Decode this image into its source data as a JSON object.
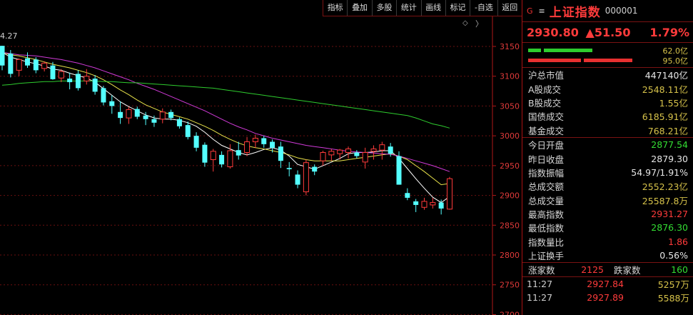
{
  "toolbar": {
    "buttons": [
      "指标",
      "叠加",
      "多股",
      "统计",
      "画线",
      "标记",
      "-自选",
      "返回"
    ]
  },
  "panel": {
    "g_icon": "G",
    "menu_icon": "≡",
    "index_name": "上证指数",
    "index_code": "000001",
    "last": "2930.80",
    "change": "▲51.50",
    "change_pct": "1.79%",
    "bar1_val": "62.0亿",
    "bar2_val": "95.0亿",
    "stats": [
      {
        "label": "沪总市值",
        "value": "447140亿",
        "color": "white"
      },
      {
        "label": "A股成交",
        "value": "2548.11亿",
        "color": "yellow"
      },
      {
        "label": "B股成交",
        "value": "1.55亿",
        "color": "yellow"
      },
      {
        "label": "国债成交",
        "value": "6185.91亿",
        "color": "yellow"
      },
      {
        "label": "基金成交",
        "value": "768.21亿",
        "color": "yellow"
      }
    ],
    "stats2": [
      {
        "label": "今日开盘",
        "value": "2877.54",
        "color": "green"
      },
      {
        "label": "昨日收盘",
        "value": "2879.30",
        "color": "white"
      },
      {
        "label": "指数振幅",
        "value": "54.97/1.91%",
        "color": "white"
      },
      {
        "label": "总成交额",
        "value": "2552.23亿",
        "color": "yellow"
      },
      {
        "label": "总成交量",
        "value": "25587.8万",
        "color": "yellow"
      },
      {
        "label": "最高指数",
        "value": "2931.27",
        "color": "red"
      },
      {
        "label": "最低指数",
        "value": "2876.30",
        "color": "green"
      },
      {
        "label": "指数量比",
        "value": "1.86",
        "color": "red"
      },
      {
        "label": "上证换手",
        "value": "0.56%",
        "color": "white"
      }
    ],
    "up_label": "涨家数",
    "up_count": "2125",
    "down_label": "跌家数",
    "down_count": "160",
    "ticks": [
      {
        "time": "11:27",
        "price": "2927.84",
        "vol": "5257万"
      },
      {
        "time": "11:27",
        "price": "2927.89",
        "vol": "5588万"
      }
    ]
  },
  "chart_data": {
    "type": "candlestick",
    "top_label": "4.27",
    "y_ticks": [
      "3150",
      "3100",
      "3050",
      "3000",
      "2950",
      "2900",
      "2850",
      "2800",
      "2750",
      "2700"
    ],
    "ylim": [
      2700,
      3175
    ],
    "candles": [
      [
        3151,
        3151,
        3110,
        3118
      ],
      [
        3138,
        3144,
        3098,
        3104
      ],
      [
        3110,
        3130,
        3100,
        3128
      ],
      [
        3130,
        3140,
        3114,
        3118
      ],
      [
        3128,
        3132,
        3105,
        3110
      ],
      [
        3113,
        3125,
        3108,
        3122
      ],
      [
        3118,
        3124,
        3094,
        3095
      ],
      [
        3097,
        3112,
        3090,
        3108
      ],
      [
        3096,
        3106,
        3078,
        3090
      ],
      [
        3104,
        3110,
        3076,
        3080
      ],
      [
        3092,
        3112,
        3086,
        3100
      ],
      [
        3096,
        3102,
        3069,
        3074
      ],
      [
        3080,
        3084,
        3051,
        3056
      ],
      [
        3058,
        3068,
        3037,
        3050
      ],
      [
        3040,
        3058,
        3020,
        3030
      ],
      [
        3030,
        3048,
        3020,
        3044
      ],
      [
        3045,
        3049,
        3028,
        3032
      ],
      [
        3034,
        3040,
        3018,
        3028
      ],
      [
        3028,
        3034,
        3015,
        3022
      ],
      [
        3028,
        3046,
        3021,
        3040
      ],
      [
        3040,
        3044,
        3026,
        3030
      ],
      [
        3028,
        3031,
        3012,
        3016
      ],
      [
        3018,
        3024,
        2994,
        2998
      ],
      [
        3000,
        3006,
        2974,
        2980
      ],
      [
        2985,
        2989,
        2948,
        2955
      ],
      [
        2960,
        2978,
        2940,
        2974
      ],
      [
        2968,
        2974,
        2947,
        2952
      ],
      [
        2948,
        2986,
        2945,
        2975
      ],
      [
        2976,
        2990,
        2960,
        2967
      ],
      [
        2972,
        2998,
        2966,
        2990
      ],
      [
        2990,
        3002,
        2980,
        2996
      ],
      [
        2996,
        3000,
        2980,
        2986
      ],
      [
        2990,
        2994,
        2972,
        2980
      ],
      [
        2982,
        2990,
        2946,
        2958
      ],
      [
        2946,
        2956,
        2932,
        2944
      ],
      [
        2935,
        2942,
        2912,
        2918
      ],
      [
        2906,
        2960,
        2900,
        2955
      ],
      [
        2948,
        2952,
        2934,
        2940
      ],
      [
        2958,
        2975,
        2950,
        2972
      ],
      [
        2968,
        2978,
        2958,
        2974
      ],
      [
        2970,
        2978,
        2960,
        2976
      ],
      [
        2972,
        2982,
        2962,
        2978
      ],
      [
        2972,
        2976,
        2962,
        2966
      ],
      [
        2956,
        2980,
        2945,
        2972
      ],
      [
        2974,
        2984,
        2960,
        2978
      ],
      [
        2976,
        2990,
        2960,
        2985
      ],
      [
        2982,
        2988,
        2965,
        2970
      ],
      [
        2966,
        2974,
        2918,
        2918
      ],
      [
        2904,
        2912,
        2892,
        2896
      ],
      [
        2890,
        2894,
        2872,
        2884
      ],
      [
        2880,
        2896,
        2876,
        2890
      ],
      [
        2884,
        2896,
        2878,
        2888
      ],
      [
        2888,
        2893,
        2868,
        2878
      ],
      [
        2877,
        2931,
        2876,
        2928
      ]
    ],
    "ma_series": [
      {
        "color": "#ffffff",
        "values": [
          3140,
          3132,
          3128,
          3124,
          3121,
          3117,
          3112,
          3110,
          3105,
          3101,
          3097,
          3090,
          3079,
          3068,
          3057,
          3049,
          3042,
          3035,
          3030,
          3028,
          3028,
          3026,
          3022,
          3016,
          3006,
          2994,
          2984,
          2978,
          2972,
          2968,
          2972,
          2977,
          2980,
          2976,
          2966,
          2952,
          2948,
          2944,
          2950,
          2956,
          2962,
          2970,
          2972,
          2972,
          2973,
          2975,
          2975,
          2962,
          2945,
          2928,
          2912,
          2897,
          2888,
          2898
        ]
      },
      {
        "color": "#e8e24a",
        "values": [
          3140,
          3136,
          3134,
          3131,
          3128,
          3124,
          3120,
          3117,
          3114,
          3110,
          3106,
          3101,
          3094,
          3086,
          3077,
          3069,
          3060,
          3052,
          3046,
          3040,
          3036,
          3032,
          3028,
          3022,
          3016,
          3009,
          3001,
          2994,
          2988,
          2983,
          2980,
          2978,
          2975,
          2972,
          2968,
          2963,
          2960,
          2958,
          2958,
          2958,
          2958,
          2960,
          2962,
          2964,
          2966,
          2968,
          2970,
          2966,
          2960,
          2950,
          2940,
          2929,
          2918,
          2920
        ]
      },
      {
        "color": "#d03ad8",
        "values": [
          3140,
          3138,
          3136,
          3135,
          3134,
          3132,
          3130,
          3128,
          3125,
          3122,
          3118,
          3114,
          3109,
          3104,
          3099,
          3094,
          3088,
          3083,
          3078,
          3072,
          3066,
          3060,
          3054,
          3048,
          3042,
          3035,
          3028,
          3021,
          3015,
          3010,
          3004,
          3000,
          2996,
          2993,
          2990,
          2987,
          2984,
          2982,
          2980,
          2978,
          2976,
          2974,
          2973,
          2972,
          2971,
          2970,
          2969,
          2966,
          2962,
          2958,
          2954,
          2950,
          2945,
          2940
        ]
      },
      {
        "color": "#2ecc2e",
        "values": [
          3085,
          3086,
          3088,
          3089,
          3090,
          3091,
          3091,
          3092,
          3092,
          3092,
          3092,
          3092,
          3091,
          3091,
          3090,
          3089,
          3089,
          3088,
          3087,
          3086,
          3085,
          3084,
          3083,
          3082,
          3081,
          3080,
          3078,
          3076,
          3074,
          3072,
          3070,
          3068,
          3066,
          3064,
          3062,
          3060,
          3058,
          3056,
          3054,
          3052,
          3050,
          3048,
          3046,
          3044,
          3042,
          3040,
          3038,
          3036,
          3034,
          3030,
          3025,
          3020,
          3017,
          3013
        ]
      }
    ],
    "ma_lengths": [
      54,
      54,
      54,
      54
    ]
  }
}
